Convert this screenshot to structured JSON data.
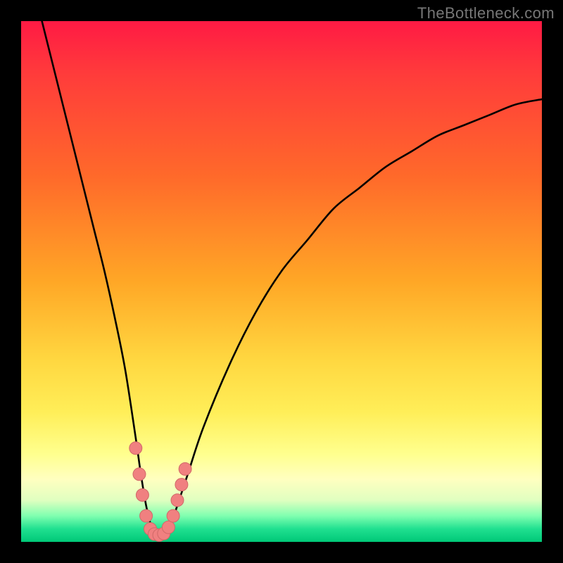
{
  "watermark": "TheBottleneck.com",
  "colors": {
    "frame": "#000000",
    "curve": "#000000",
    "marker_fill": "#f08080",
    "marker_stroke": "#d06868",
    "gradient_top": "#ff1a44",
    "gradient_bottom": "#00c878"
  },
  "chart_data": {
    "type": "line",
    "title": "",
    "xlabel": "",
    "ylabel": "",
    "xlim": [
      0,
      100
    ],
    "ylim": [
      0,
      100
    ],
    "legend": false,
    "grid": false,
    "annotations": [
      "TheBottleneck.com"
    ],
    "series": [
      {
        "name": "bottleneck-curve",
        "x": [
          4,
          6,
          8,
          10,
          12,
          14,
          16,
          18,
          20,
          22,
          23,
          24,
          25,
          26,
          27,
          28,
          29,
          30,
          32,
          35,
          40,
          45,
          50,
          55,
          60,
          65,
          70,
          75,
          80,
          85,
          90,
          95,
          100
        ],
        "y": [
          100,
          92,
          84,
          76,
          68,
          60,
          52,
          43,
          33,
          20,
          13,
          7,
          3,
          1,
          1,
          2,
          4,
          7,
          13,
          22,
          34,
          44,
          52,
          58,
          64,
          68,
          72,
          75,
          78,
          80,
          82,
          84,
          85
        ]
      }
    ],
    "markers": [
      {
        "x": 22.0,
        "y": 18
      },
      {
        "x": 22.7,
        "y": 13
      },
      {
        "x": 23.3,
        "y": 9
      },
      {
        "x": 24.0,
        "y": 5
      },
      {
        "x": 24.8,
        "y": 2.5
      },
      {
        "x": 25.6,
        "y": 1.5
      },
      {
        "x": 26.5,
        "y": 1.3
      },
      {
        "x": 27.4,
        "y": 1.6
      },
      {
        "x": 28.3,
        "y": 2.8
      },
      {
        "x": 29.2,
        "y": 5
      },
      {
        "x": 30.0,
        "y": 8
      },
      {
        "x": 30.8,
        "y": 11
      },
      {
        "x": 31.5,
        "y": 14
      }
    ]
  }
}
